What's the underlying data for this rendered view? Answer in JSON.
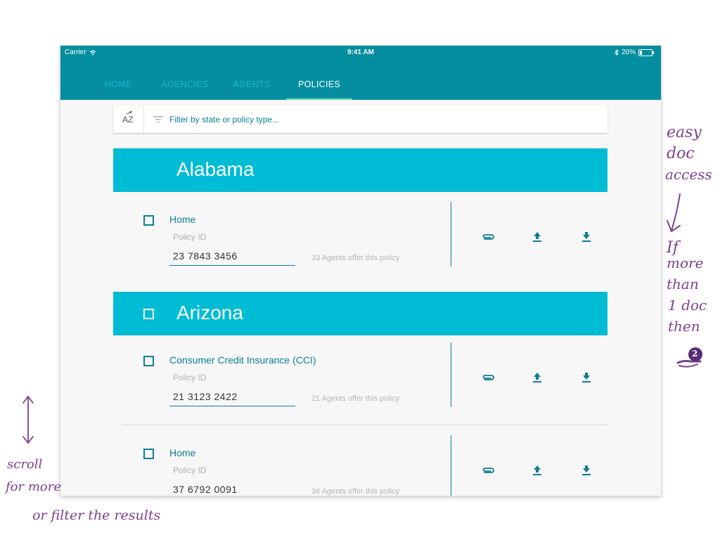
{
  "status_bar": {
    "carrier": "Carrier",
    "time": "9:41 AM",
    "battery": "20%",
    "battery_level": 0.2
  },
  "nav": {
    "tabs": [
      {
        "label": "HOME"
      },
      {
        "label": "AGENCIES"
      },
      {
        "label": "AGENTS"
      },
      {
        "label": "POLICIES",
        "active": true
      }
    ]
  },
  "filter": {
    "sort_icon": "sort-az-icon",
    "filter_icon": "filter-icon",
    "placeholder": "Filter by state or policy type..."
  },
  "states": [
    {
      "name": "Alabama",
      "policies": [
        {
          "name": "Home",
          "id_label": "Policy ID",
          "id": "23  7843  3456",
          "agents_note": "33 Agents offer this policy"
        }
      ]
    },
    {
      "name": "Arizona",
      "policies": [
        {
          "name": "Consumer Credit Insurance (CCI)",
          "id_label": "Policy ID",
          "id": "21  3123  2422",
          "agents_note": "21 Agents offer this policy"
        },
        {
          "name": "Home",
          "id_label": "Policy ID",
          "id": "37  6792  0091",
          "agents_note": "36 Agents offer this policy"
        }
      ]
    }
  ],
  "row_actions": [
    "attachment-icon",
    "upload-icon",
    "download-icon"
  ],
  "annotations": {
    "right": [
      "easy",
      "doc",
      "access",
      "If",
      "more",
      "than",
      "1 doc",
      "then"
    ],
    "badge": "2",
    "left": [
      "scroll",
      "for more",
      "or filter the results"
    ]
  },
  "colors": {
    "primary_dark": "#048ea0",
    "header_cyan": "#00bcd4",
    "accent_teal": "#0b7f92",
    "active_tab_underline": "#64e0a8",
    "annotation_purple": "#7e3f8f"
  }
}
